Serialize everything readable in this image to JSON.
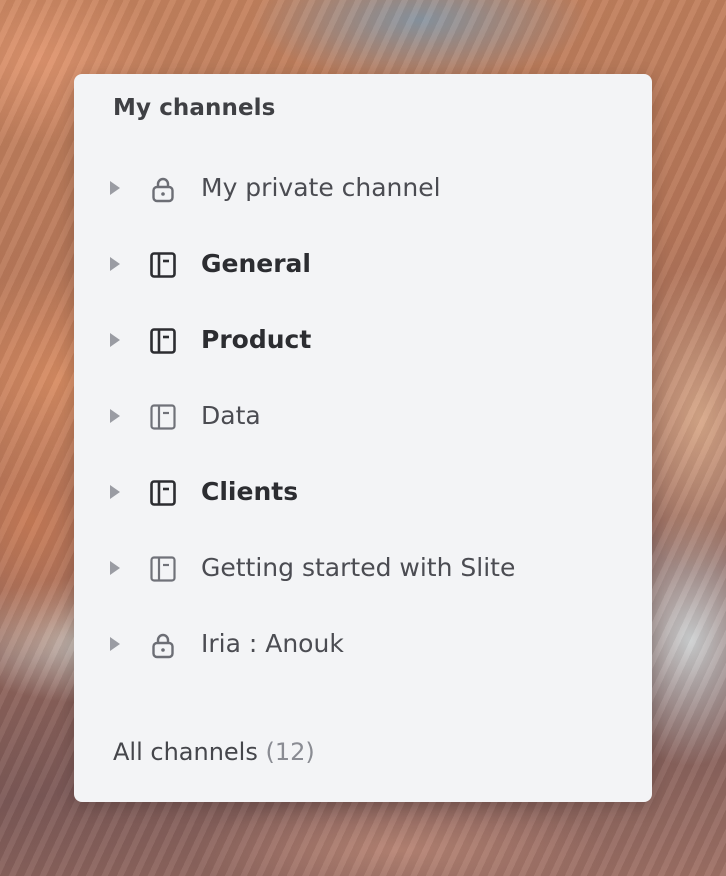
{
  "panel": {
    "title": "My channels",
    "channels": [
      {
        "label": "My private channel",
        "icon": "lock-icon",
        "bold": false
      },
      {
        "label": "General",
        "icon": "channel-icon",
        "bold": true
      },
      {
        "label": "Product",
        "icon": "channel-icon",
        "bold": true
      },
      {
        "label": "Data",
        "icon": "channel-icon",
        "bold": false
      },
      {
        "label": "Clients",
        "icon": "channel-icon",
        "bold": true
      },
      {
        "label": "Getting started with Slite",
        "icon": "channel-icon",
        "bold": false
      },
      {
        "label": "Iria : Anouk",
        "icon": "lock-icon",
        "bold": false
      }
    ],
    "footer": {
      "label": "All channels",
      "count": "(12)"
    }
  },
  "colors": {
    "panel_bg": "#f3f4f6",
    "text_primary": "#2c2d31",
    "text_regular": "#4b4c52",
    "muted": "#8a8c93"
  }
}
